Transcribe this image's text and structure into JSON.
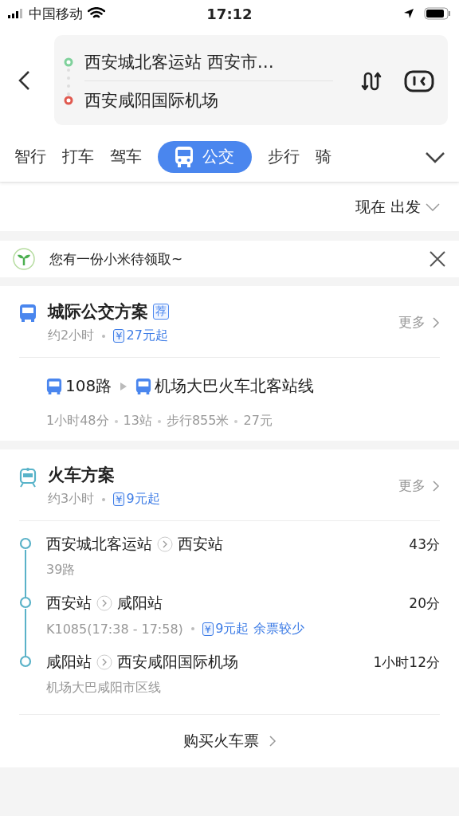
{
  "status_bar": {
    "carrier": "中国移动",
    "time": "17:12"
  },
  "route": {
    "origin": "西安城北客运站 西安市…",
    "destination": "西安咸阳国际机场"
  },
  "tabs": [
    {
      "label": "智行",
      "selected": false
    },
    {
      "label": "打车",
      "selected": false
    },
    {
      "label": "驾车",
      "selected": false
    },
    {
      "label": "公交",
      "selected": true
    },
    {
      "label": "步行",
      "selected": false
    },
    {
      "label": "骑",
      "selected": false
    }
  ],
  "departure": "现在 出发",
  "promo": {
    "text": "您有一份小米待领取~"
  },
  "bus_plan": {
    "title": "城际公交方案",
    "badge": "荐",
    "duration": "约2小时",
    "price_symbol": "¥",
    "price": "27元起",
    "more": "更多",
    "legs": [
      "108路",
      "机场大巴火车北客站线"
    ],
    "summary": [
      "1小时48分",
      "13站",
      "步行855米",
      "27元"
    ]
  },
  "train_plan": {
    "title": "火车方案",
    "duration": "约3小时",
    "price_symbol": "¥",
    "price": "9元起",
    "more": "更多",
    "steps": [
      {
        "from": "西安城北客运站",
        "to": "西安站",
        "time": "43分",
        "detail": "39路"
      },
      {
        "from": "西安站",
        "to": "咸阳站",
        "time": "20分",
        "detail": "K1085(17:38 - 17:58)",
        "price_symbol": "¥",
        "price": "9元起",
        "note": "余票较少"
      },
      {
        "from": "咸阳站",
        "to": "西安咸阳国际机场",
        "time": "1小时12分",
        "detail": "机场大巴咸阳市区线"
      }
    ],
    "button": "购买火车票"
  }
}
